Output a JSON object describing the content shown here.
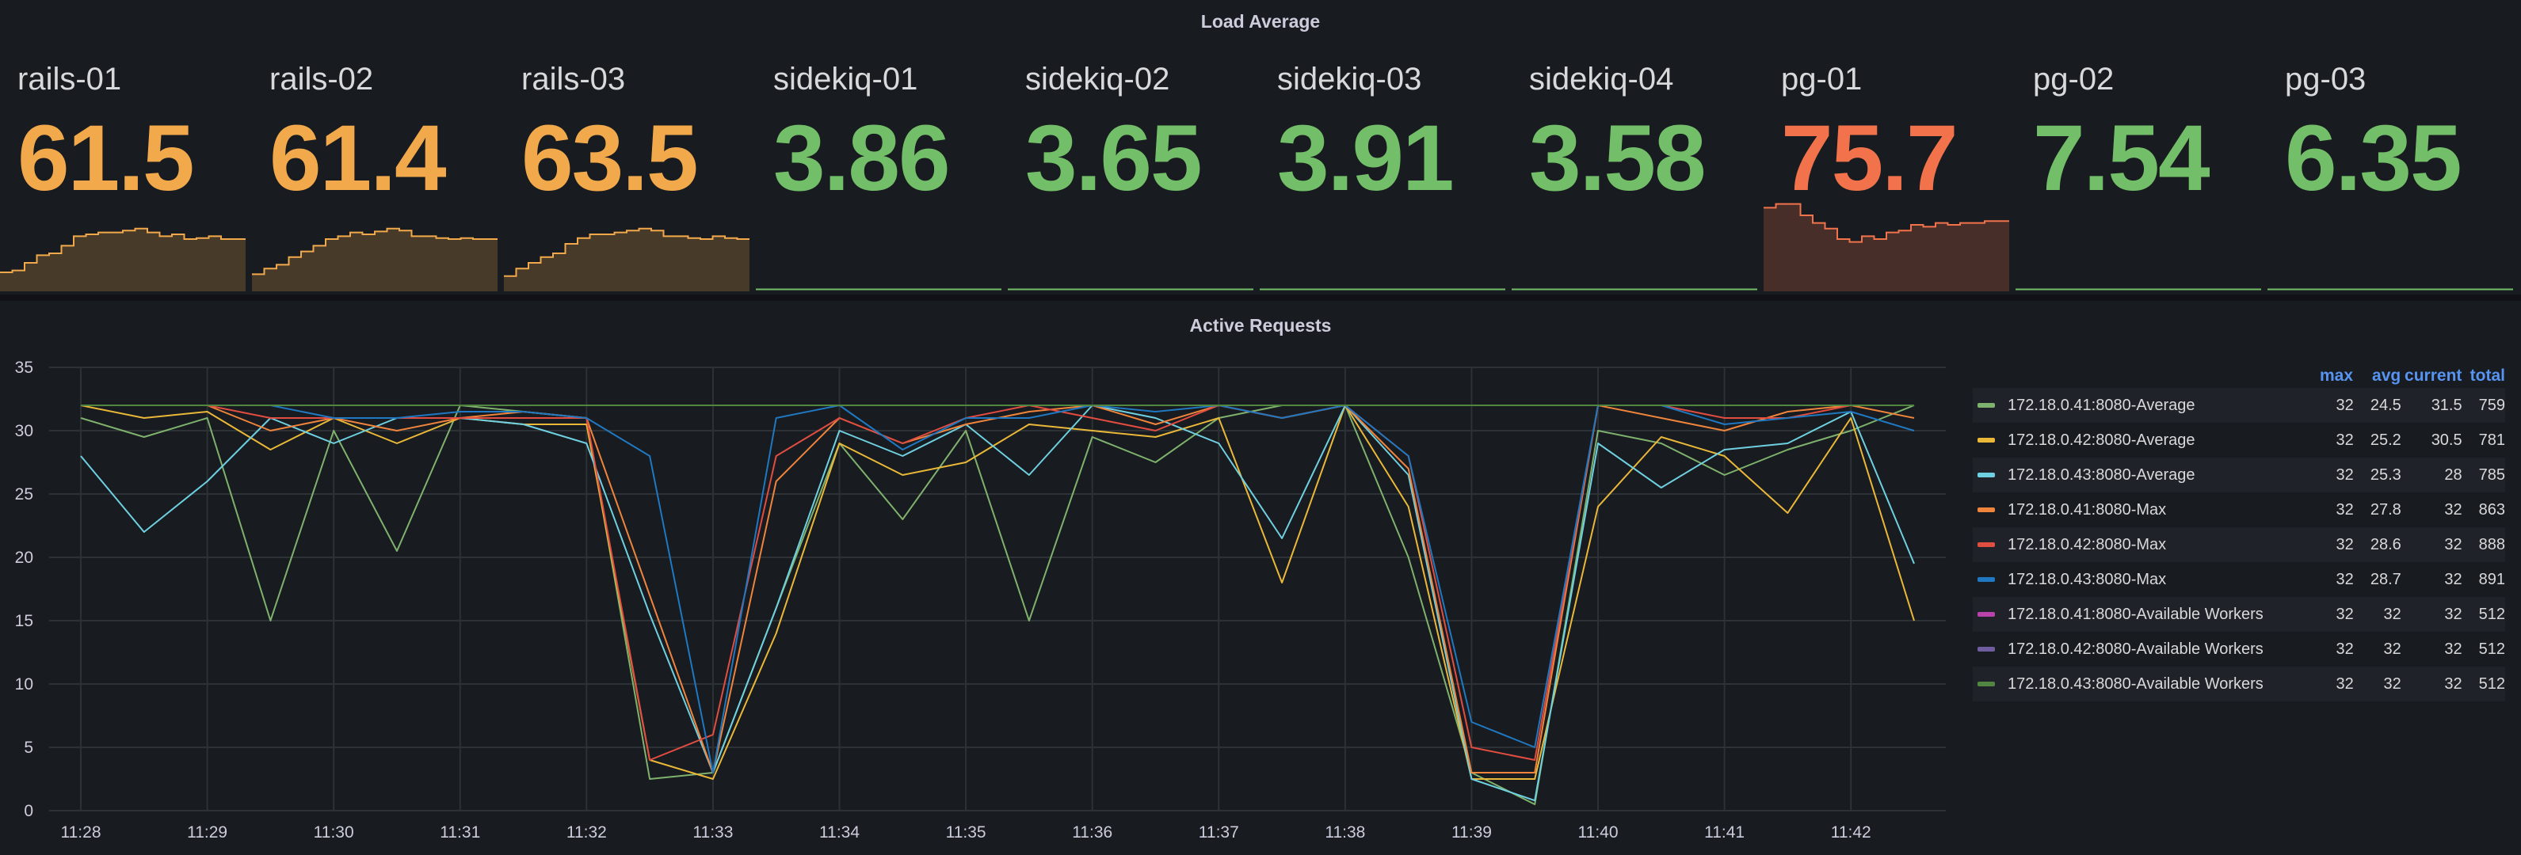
{
  "load_panel": {
    "title": "Load Average",
    "stats": [
      {
        "name": "rails-01",
        "value": "61.5",
        "color": "#f2a94b",
        "level": 0.8,
        "spark": [
          0.2,
          0.22,
          0.3,
          0.38,
          0.4,
          0.48,
          0.58,
          0.6,
          0.62,
          0.62,
          0.64,
          0.66,
          0.62,
          0.58,
          0.6,
          0.55,
          0.56,
          0.58,
          0.55,
          0.55
        ]
      },
      {
        "name": "rails-02",
        "value": "61.4",
        "color": "#f2a94b",
        "level": 0.8,
        "spark": [
          0.18,
          0.24,
          0.28,
          0.36,
          0.42,
          0.48,
          0.55,
          0.58,
          0.62,
          0.6,
          0.63,
          0.66,
          0.64,
          0.58,
          0.58,
          0.56,
          0.55,
          0.56,
          0.55,
          0.55
        ]
      },
      {
        "name": "rails-03",
        "value": "63.5",
        "color": "#f2a94b",
        "level": 0.8,
        "spark": [
          0.16,
          0.24,
          0.3,
          0.36,
          0.4,
          0.5,
          0.56,
          0.6,
          0.6,
          0.62,
          0.64,
          0.66,
          0.64,
          0.58,
          0.58,
          0.56,
          0.55,
          0.58,
          0.56,
          0.55
        ]
      },
      {
        "name": "sidekiq-01",
        "value": "3.86",
        "color": "#73bf69",
        "level": 0.04,
        "spark": []
      },
      {
        "name": "sidekiq-02",
        "value": "3.65",
        "color": "#73bf69",
        "level": 0.04,
        "spark": []
      },
      {
        "name": "sidekiq-03",
        "value": "3.91",
        "color": "#73bf69",
        "level": 0.04,
        "spark": []
      },
      {
        "name": "sidekiq-04",
        "value": "3.58",
        "color": "#73bf69",
        "level": 0.04,
        "spark": []
      },
      {
        "name": "pg-01",
        "value": "75.7",
        "color": "#f2734b",
        "level": 0.9,
        "spark": [
          0.88,
          0.92,
          0.92,
          0.8,
          0.72,
          0.66,
          0.55,
          0.52,
          0.58,
          0.55,
          0.62,
          0.64,
          0.7,
          0.68,
          0.72,
          0.7,
          0.72,
          0.72,
          0.74,
          0.74
        ]
      },
      {
        "name": "pg-02",
        "value": "7.54",
        "color": "#73bf69",
        "level": 0.04,
        "spark": []
      },
      {
        "name": "pg-03",
        "value": "6.35",
        "color": "#73bf69",
        "level": 0.04,
        "spark": []
      }
    ]
  },
  "requests_panel": {
    "title": "Active Requests",
    "legend_headers": {
      "max": "max",
      "avg": "avg",
      "current": "current",
      "total": "total"
    },
    "legend": [
      {
        "name": "172.18.0.41:8080-Average",
        "color": "#7eb26d",
        "max": "32",
        "avg": "24.5",
        "current": "31.5",
        "total": "759"
      },
      {
        "name": "172.18.0.42:8080-Average",
        "color": "#eab839",
        "max": "32",
        "avg": "25.2",
        "current": "30.5",
        "total": "781"
      },
      {
        "name": "172.18.0.43:8080-Average",
        "color": "#6ed0e0",
        "max": "32",
        "avg": "25.3",
        "current": "28",
        "total": "785"
      },
      {
        "name": "172.18.0.41:8080-Max",
        "color": "#ef843c",
        "max": "32",
        "avg": "27.8",
        "current": "32",
        "total": "863"
      },
      {
        "name": "172.18.0.42:8080-Max",
        "color": "#e24d42",
        "max": "32",
        "avg": "28.6",
        "current": "32",
        "total": "888"
      },
      {
        "name": "172.18.0.43:8080-Max",
        "color": "#1f78c1",
        "max": "32",
        "avg": "28.7",
        "current": "32",
        "total": "891"
      },
      {
        "name": "172.18.0.41:8080-Available Workers",
        "color": "#ba43a9",
        "max": "32",
        "avg": "32",
        "current": "32",
        "total": "512"
      },
      {
        "name": "172.18.0.42:8080-Available Workers",
        "color": "#705da0",
        "max": "32",
        "avg": "32",
        "current": "32",
        "total": "512"
      },
      {
        "name": "172.18.0.43:8080-Available Workers",
        "color": "#508642",
        "max": "32",
        "avg": "32",
        "current": "32",
        "total": "512"
      }
    ]
  },
  "chart_data": {
    "type": "line",
    "title": "Active Requests",
    "ylim": [
      0,
      35
    ],
    "yticks": [
      0,
      5,
      10,
      15,
      20,
      25,
      30,
      35
    ],
    "xticks": [
      "11:28",
      "11:29",
      "11:30",
      "11:31",
      "11:32",
      "11:33",
      "11:34",
      "11:35",
      "11:36",
      "11:37",
      "11:38",
      "11:39",
      "11:40",
      "11:41",
      "11:42"
    ],
    "xlim": [
      0,
      14.5
    ],
    "grid": true,
    "legend_position": "right",
    "x": [
      0,
      0.5,
      1,
      1.5,
      2,
      2.5,
      3,
      3.5,
      4,
      4.5,
      5,
      5.5,
      6,
      6.5,
      7,
      7.5,
      8,
      8.5,
      9,
      9.5,
      10,
      10.5,
      11,
      11.5,
      12,
      12.5,
      13,
      13.5,
      14,
      14.5
    ],
    "series": [
      {
        "name": "172.18.0.41:8080-Average",
        "values": [
          31,
          29.5,
          31,
          15,
          30,
          20.5,
          32,
          31.5,
          31,
          2.5,
          3,
          16,
          29,
          23,
          30,
          15,
          29.5,
          27.5,
          31,
          32,
          32,
          20,
          3,
          0.5,
          30,
          29,
          26.5,
          28.5,
          30,
          32
        ]
      },
      {
        "name": "172.18.0.42:8080-Average",
        "values": [
          32,
          31,
          31.5,
          28.5,
          31,
          29,
          31,
          30.5,
          30.5,
          4,
          2.5,
          14,
          29,
          26.5,
          27.5,
          30.5,
          30,
          29.5,
          31,
          18,
          32,
          24,
          2.5,
          2.5,
          24,
          29.5,
          28,
          23.5,
          31,
          15
        ]
      },
      {
        "name": "172.18.0.43:8080-Average",
        "values": [
          28,
          22,
          26,
          31,
          29,
          31,
          31,
          30.5,
          29,
          15.5,
          3,
          16,
          30,
          28,
          30.5,
          26.5,
          32,
          31,
          29,
          21.5,
          32,
          26.5,
          2.5,
          0.8,
          29,
          25.5,
          28.5,
          29,
          31.5,
          19.5
        ]
      },
      {
        "name": "172.18.0.41:8080-Max",
        "values": [
          32,
          32,
          32,
          30,
          31,
          30,
          31,
          31.5,
          31,
          17,
          3,
          26,
          31,
          29,
          30.5,
          31.5,
          32,
          30.5,
          32,
          31,
          32,
          27,
          3,
          3,
          32,
          31,
          30,
          31.5,
          32,
          31
        ]
      },
      {
        "name": "172.18.0.42:8080-Max",
        "values": [
          32,
          32,
          32,
          31,
          31,
          31,
          31,
          31,
          31,
          4,
          6,
          28,
          31,
          29,
          31,
          32,
          31,
          30,
          32,
          31,
          32,
          28,
          5,
          4,
          32,
          32,
          31,
          31,
          32,
          32
        ]
      },
      {
        "name": "172.18.0.43:8080-Max",
        "values": [
          32,
          32,
          32,
          32,
          31,
          31,
          31.5,
          31.5,
          31,
          28,
          3,
          31,
          32,
          28.5,
          31,
          31,
          32,
          31.5,
          32,
          31,
          32,
          28,
          7,
          5,
          32,
          32,
          30.5,
          31,
          31.5,
          30
        ]
      },
      {
        "name": "172.18.0.41:8080-Available Workers",
        "values": [
          32,
          32,
          32,
          32,
          32,
          32,
          32,
          32,
          32,
          32,
          32,
          32,
          32,
          32,
          32,
          32,
          32,
          32,
          32,
          32,
          32,
          32,
          32,
          32,
          32,
          32,
          32,
          32,
          32,
          32
        ]
      },
      {
        "name": "172.18.0.42:8080-Available Workers",
        "values": [
          32,
          32,
          32,
          32,
          32,
          32,
          32,
          32,
          32,
          32,
          32,
          32,
          32,
          32,
          32,
          32,
          32,
          32,
          32,
          32,
          32,
          32,
          32,
          32,
          32,
          32,
          32,
          32,
          32,
          32
        ]
      },
      {
        "name": "172.18.0.43:8080-Available Workers",
        "values": [
          32,
          32,
          32,
          32,
          32,
          32,
          32,
          32,
          32,
          32,
          32,
          32,
          32,
          32,
          32,
          32,
          32,
          32,
          32,
          32,
          32,
          32,
          32,
          32,
          32,
          32,
          32,
          32,
          32,
          32
        ]
      }
    ]
  }
}
